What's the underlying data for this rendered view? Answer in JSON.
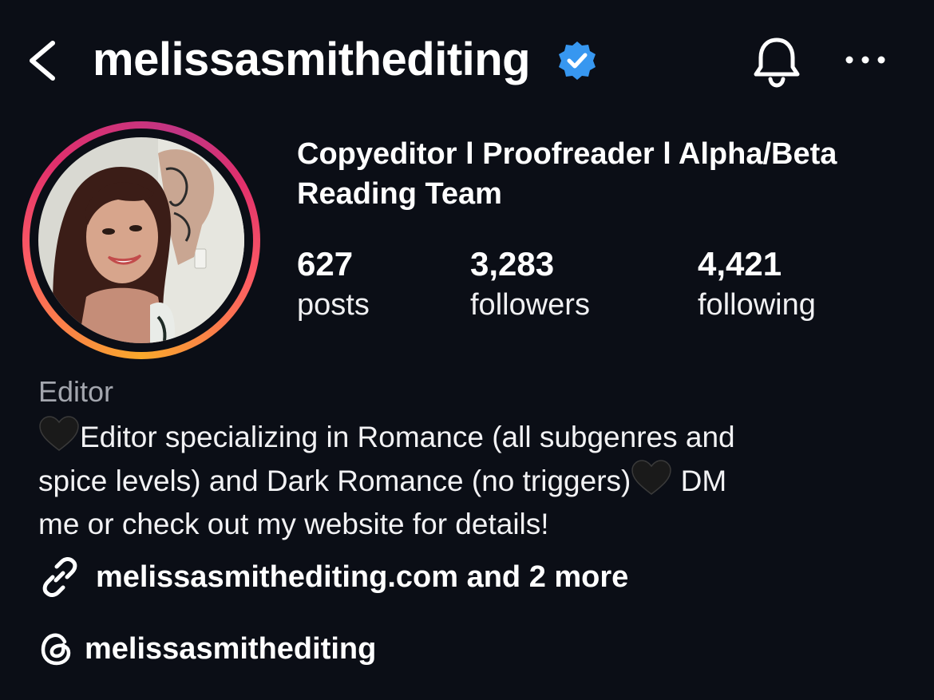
{
  "header": {
    "username": "melissasmithediting",
    "verified": true,
    "back_icon": "chevron-left-icon",
    "bell_icon": "bell-icon",
    "more_icon": "more-horizontal-icon"
  },
  "profile": {
    "avatar_icon": "profile-photo",
    "story_ring_colors": [
      "#f9a92b",
      "#fd5c63",
      "#e1306c",
      "#c13584"
    ],
    "title_line1": "Copyeditor l Proofreader l Alpha/Beta",
    "title_line2": "Reading Team"
  },
  "stats": [
    {
      "value": "627",
      "label": "posts"
    },
    {
      "value": "3,283",
      "label": "followers"
    },
    {
      "value": "4,421",
      "label": "following"
    }
  ],
  "bio": {
    "category": "Editor",
    "line1_text": "Editor specializing in Romance (all subgenres and",
    "line2_text": "spice levels) and Dark Romance (no triggers)",
    "line2_tail": " DM",
    "line3_text": "me or check out my website for details!",
    "emoji": "black-heart-icon"
  },
  "links": {
    "text": "melissasmithediting.com and 2 more",
    "icon": "link-icon"
  },
  "threads": {
    "handle": "melissasmithediting",
    "icon": "threads-icon"
  },
  "colors": {
    "background": "#0b0e16",
    "verified_badge": "#3797f0",
    "secondary_text": "#a3a6ae"
  }
}
